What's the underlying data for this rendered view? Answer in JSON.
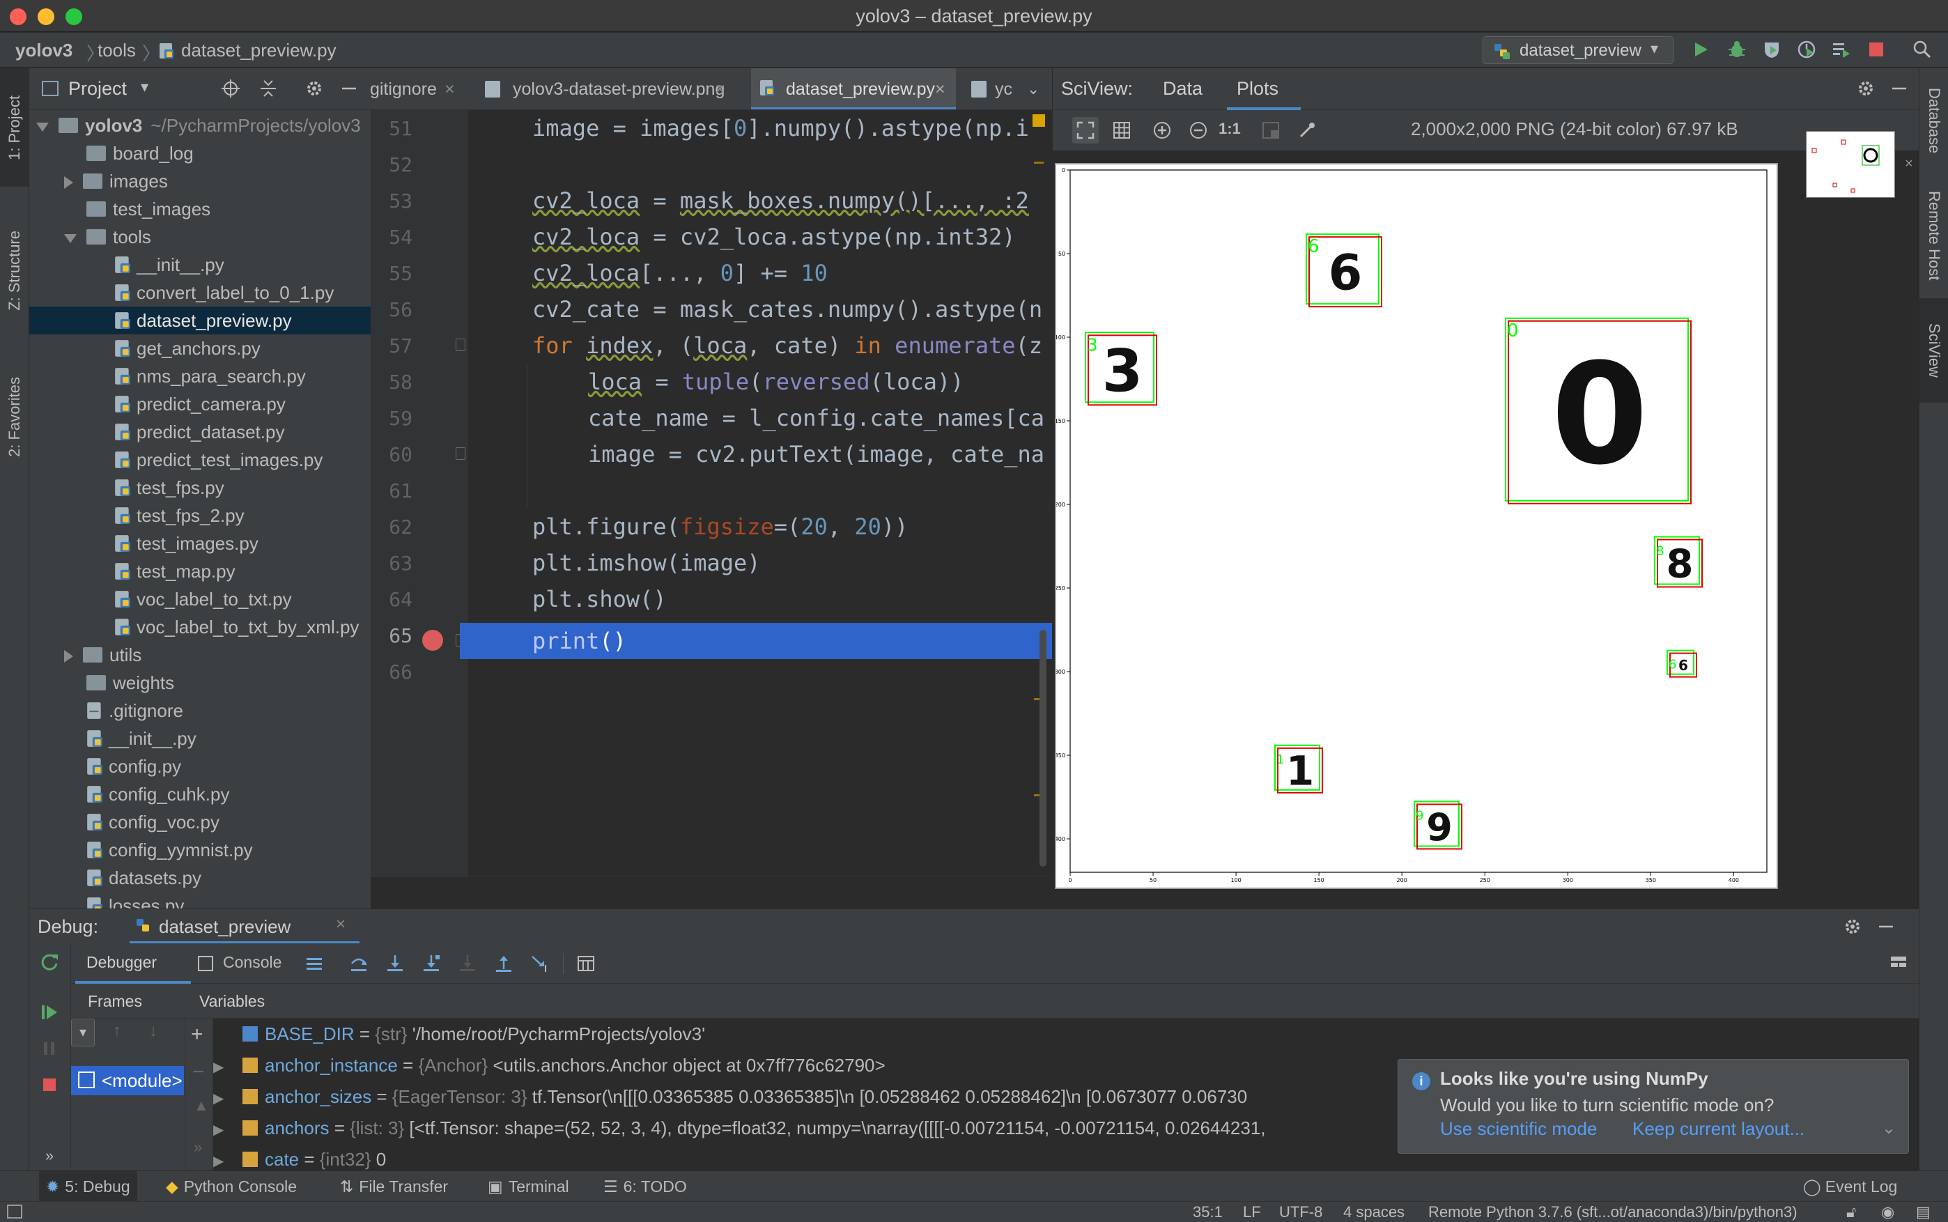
{
  "window": {
    "title": "yolov3 – dataset_preview.py"
  },
  "breadcrumb": [
    "yolov3",
    "tools",
    "dataset_preview.py"
  ],
  "run_config": "dataset_preview",
  "left_strip": {
    "project": "1: Project",
    "structure": "Z: Structure",
    "favorites": "2: Favorites"
  },
  "right_strip": {
    "database": "Database",
    "remote_host": "Remote Host",
    "sciview": "SciView"
  },
  "project": {
    "title": "Project",
    "tree": [
      {
        "label": "yolov3",
        "extra": "~/PycharmProjects/yolov3",
        "type": "root",
        "depth": 0,
        "state": "open"
      },
      {
        "label": "board_log",
        "type": "folder",
        "depth": 1
      },
      {
        "label": "images",
        "type": "folder",
        "depth": 1,
        "state": "closed"
      },
      {
        "label": "test_images",
        "type": "folder",
        "depth": 1
      },
      {
        "label": "tools",
        "type": "folder",
        "depth": 1,
        "state": "open"
      },
      {
        "label": "__init__.py",
        "type": "py",
        "depth": 2
      },
      {
        "label": "convert_label_to_0_1.py",
        "type": "py",
        "depth": 2
      },
      {
        "label": "dataset_preview.py",
        "type": "py",
        "depth": 2,
        "selected": true
      },
      {
        "label": "get_anchors.py",
        "type": "py",
        "depth": 2
      },
      {
        "label": "nms_para_search.py",
        "type": "py",
        "depth": 2
      },
      {
        "label": "predict_camera.py",
        "type": "py",
        "depth": 2
      },
      {
        "label": "predict_dataset.py",
        "type": "py",
        "depth": 2
      },
      {
        "label": "predict_test_images.py",
        "type": "py",
        "depth": 2
      },
      {
        "label": "test_fps.py",
        "type": "py",
        "depth": 2
      },
      {
        "label": "test_fps_2.py",
        "type": "py",
        "depth": 2
      },
      {
        "label": "test_images.py",
        "type": "py",
        "depth": 2
      },
      {
        "label": "test_map.py",
        "type": "py",
        "depth": 2
      },
      {
        "label": "voc_label_to_txt.py",
        "type": "py",
        "depth": 2
      },
      {
        "label": "voc_label_to_txt_by_xml.py",
        "type": "py",
        "depth": 2
      },
      {
        "label": "utils",
        "type": "folder",
        "depth": 1,
        "state": "closed"
      },
      {
        "label": "weights",
        "type": "folder",
        "depth": 1
      },
      {
        "label": ".gitignore",
        "type": "file",
        "depth": 1
      },
      {
        "label": "__init__.py",
        "type": "py",
        "depth": 1
      },
      {
        "label": "config.py",
        "type": "py",
        "depth": 1
      },
      {
        "label": "config_cuhk.py",
        "type": "py",
        "depth": 1
      },
      {
        "label": "config_voc.py",
        "type": "py",
        "depth": 1
      },
      {
        "label": "config_yymnist.py",
        "type": "py",
        "depth": 1
      },
      {
        "label": "datasets.py",
        "type": "py",
        "depth": 1
      },
      {
        "label": "losses.py",
        "type": "py",
        "depth": 1
      }
    ]
  },
  "editor": {
    "tabs": [
      ".gitignore",
      "yolov3-dataset-preview.png",
      "dataset_preview.py",
      "yc"
    ],
    "active_tab": 2,
    "line_numbers": [
      "51",
      "52",
      "53",
      "54",
      "55",
      "56",
      "57",
      "58",
      "59",
      "60",
      "61",
      "62",
      "63",
      "64",
      "65",
      "66"
    ],
    "current_line": "65"
  },
  "sciview": {
    "label": "SciView:",
    "tabs": [
      "Data",
      "Plots"
    ],
    "active_tab": "Plots",
    "image_info": "2,000x2,000 PNG (24-bit color) 67.97 kB",
    "zoom_actual": "1:1",
    "boxes": [
      {
        "class": "6",
        "cx": 0.395,
        "cy": 0.145
      },
      {
        "class": "3",
        "cx": 0.075,
        "cy": 0.285
      },
      {
        "class": "0",
        "cx": 0.76,
        "cy": 0.345
      },
      {
        "class": "8",
        "cx": 0.875,
        "cy": 0.56
      },
      {
        "class": "6",
        "cx": 0.88,
        "cy": 0.705
      },
      {
        "class": "1",
        "cx": 0.33,
        "cy": 0.855
      },
      {
        "class": "9",
        "cx": 0.53,
        "cy": 0.935
      }
    ],
    "x_ticks": [
      "0",
      "50",
      "100",
      "150",
      "200",
      "250",
      "300",
      "350",
      "400"
    ],
    "y_ticks": [
      "0",
      "50",
      "100",
      "150",
      "200",
      "250",
      "300",
      "350",
      "400"
    ]
  },
  "debug": {
    "label": "Debug:",
    "session": "dataset_preview",
    "tabs": [
      "Debugger",
      "Console"
    ],
    "frames_label": "Frames",
    "variables_label": "Variables",
    "frame": "<module>",
    "variables": [
      {
        "name": "BASE_DIR",
        "type": "{str}",
        "value": "'/home/root/PycharmProjects/yolov3'",
        "expandable": false
      },
      {
        "name": "anchor_instance",
        "type": "{Anchor}",
        "value": "<utils.anchors.Anchor object at 0x7ff776c62790>",
        "expandable": true
      },
      {
        "name": "anchor_sizes",
        "type": "{EagerTensor: 3}",
        "value": "tf.Tensor(\\n[[[0.03365385 0.03365385]\\n  [0.05288462 0.05288462]\\n  [0.0673077  0.06730",
        "expandable": true
      },
      {
        "name": "anchors",
        "type": "{list: 3}",
        "value": "[<tf.Tensor: shape=(52, 52, 3, 4), dtype=float32, numpy=\\narray([[[[-0.00721154, -0.00721154,  0.02644231,",
        "expandable": true
      },
      {
        "name": "cate",
        "type": "{int32}",
        "value": "0",
        "expandable": true
      }
    ]
  },
  "notification": {
    "title": "Looks like you're using NumPy",
    "body": "Would you like to turn scientific mode on?",
    "action_primary": "Use scientific mode",
    "action_secondary": "Keep current layout..."
  },
  "bottom_tabs": [
    "5: Debug",
    "Python Console",
    "File Transfer",
    "Terminal",
    "6: TODO"
  ],
  "event_log": "Event Log",
  "status": {
    "position": "35:1",
    "line_sep": "LF",
    "encoding": "UTF-8",
    "indent": "4 spaces",
    "interpreter": "Remote Python 3.7.6 (sft...ot/anaconda3)/bin/python3)"
  },
  "colors": {
    "accent_blue": "#2f65ca",
    "run_green": "#59a869",
    "stop_red": "#e05555",
    "box_green": "#00ff00",
    "box_red": "#e00000"
  }
}
